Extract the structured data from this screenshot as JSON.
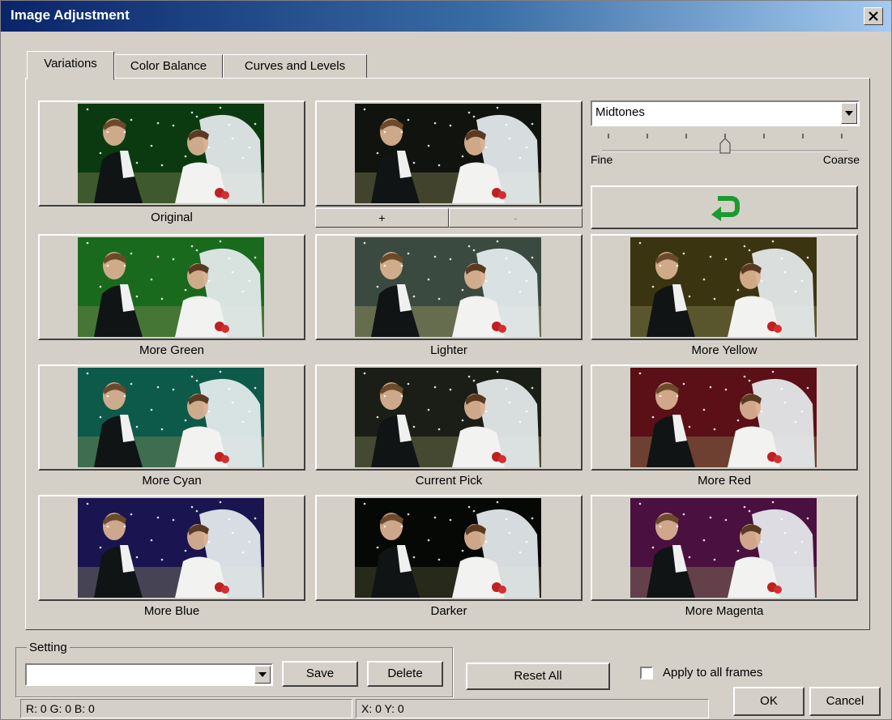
{
  "window": {
    "title": "Image Adjustment"
  },
  "tabs": [
    {
      "label": "Variations",
      "active": true
    },
    {
      "label": "Color Balance",
      "active": false
    },
    {
      "label": "Curves and Levels",
      "active": false
    }
  ],
  "variations": [
    {
      "label": "Original",
      "tint": "#0b3a10"
    },
    {
      "label": "",
      "tint": "#11140e"
    },
    {
      "label": "More Green",
      "tint": "#1a6a1e"
    },
    {
      "label": "Lighter",
      "tint": "#3b4a40"
    },
    {
      "label": "More Yellow",
      "tint": "#3a3510"
    },
    {
      "label": "More Cyan",
      "tint": "#0d5a4a"
    },
    {
      "label": "Current Pick",
      "tint": "#1a1e16"
    },
    {
      "label": "More Red",
      "tint": "#5a1016"
    },
    {
      "label": "More Blue",
      "tint": "#1a1450"
    },
    {
      "label": "Darker",
      "tint": "#060806"
    },
    {
      "label": "More Magenta",
      "tint": "#4a1040"
    }
  ],
  "plusminus": {
    "plus": "+",
    "minus": "-"
  },
  "tone_select": {
    "value": "Midtones"
  },
  "slider": {
    "min_label": "Fine",
    "max_label": "Coarse",
    "position": 0.5
  },
  "undo_icon": "undo-arrow-icon",
  "setting": {
    "label": "Setting",
    "value": ""
  },
  "buttons": {
    "save": "Save",
    "delete": "Delete",
    "reset_all": "Reset All",
    "ok": "OK",
    "cancel": "Cancel"
  },
  "apply_all": {
    "label": "Apply to all frames",
    "checked": false
  },
  "status": {
    "rgb": "R:  0 G:  0 B:  0",
    "xy": "X: 0   Y: 0"
  },
  "colors": {
    "title_start": "#0a246a",
    "title_end": "#a6caf0",
    "face": "#d4d0c8",
    "undo_arrow": "#1a9a30"
  }
}
